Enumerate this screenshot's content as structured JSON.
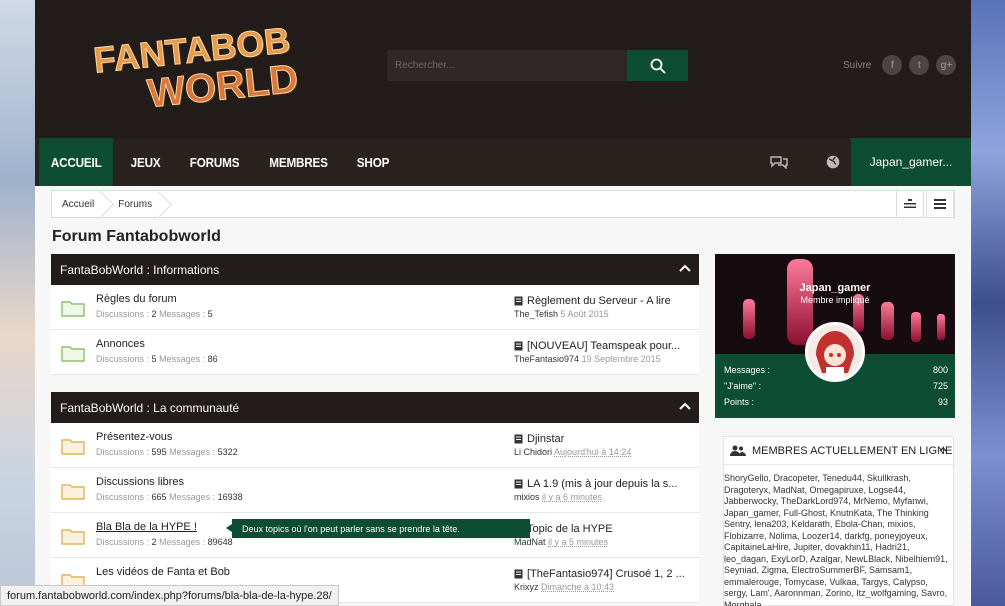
{
  "logo": {
    "line1": "FANTABOB",
    "line2": "WORLD"
  },
  "search": {
    "placeholder": "Rechercher..."
  },
  "follow": {
    "label": "Suivre",
    "icons": [
      "facebook-icon",
      "twitter-icon",
      "google-plus-icon"
    ],
    "glyphs": [
      "f",
      "t",
      "g+"
    ]
  },
  "nav": {
    "items": [
      "ACCUEIL",
      "JEUX",
      "FORUMS",
      "MEMBRES",
      "SHOP"
    ],
    "user": "Japan_gamer..."
  },
  "breadcrumb": [
    "Accueil",
    "Forums"
  ],
  "page_title": "Forum Fantabobworld",
  "categories": [
    {
      "title": "FantaBobWorld : Informations",
      "forums": [
        {
          "name": "Règles du forum",
          "discussions_label": "Discussions :",
          "discussions": "2",
          "messages_label": "Messages :",
          "messages": "5",
          "last_title": "Règlement du Serveur - A lire",
          "last_user": "The_Tefish",
          "last_date": "5 Août 2015",
          "read": true
        },
        {
          "name": "Annonces",
          "discussions_label": "Discussions :",
          "discussions": "5",
          "messages_label": "Messages :",
          "messages": "86",
          "last_title": "[NOUVEAU] Teamspeak pour...",
          "last_user": "TheFantasio974",
          "last_date": "19 Septembre 2015",
          "read": true
        }
      ]
    },
    {
      "title": "FantaBobWorld : La communauté",
      "forums": [
        {
          "name": "Présentez-vous",
          "discussions_label": "Discussions :",
          "discussions": "595",
          "messages_label": "Messages :",
          "messages": "5322",
          "last_title": "Djinstar",
          "last_user": "Li Chidori",
          "last_date": "Aujourd'hui à 14:24"
        },
        {
          "name": "Discussions libres",
          "discussions_label": "Discussions :",
          "discussions": "665",
          "messages_label": "Messages :",
          "messages": "16938",
          "last_title": "LA 1.9 (mis à jour depuis la s...",
          "last_user": "mixios",
          "last_date": "il y a 6 minutes"
        },
        {
          "name": "Bla Bla de la HYPE !",
          "discussions_label": "Discussions :",
          "discussions": "2",
          "messages_label": "Messages :",
          "messages": "89648",
          "last_title": "Topic de la HYPE",
          "last_user": "MadNat",
          "last_date": "il y a 5 minutes"
        },
        {
          "name": "Les vidéos de Fanta et Bob",
          "discussions_label": "",
          "discussions": "",
          "messages_label": "",
          "messages": "",
          "last_title": "[TheFantasio974] Crusoé 1, 2 ...",
          "last_user": "Krixyz",
          "last_date": "Dimanche à 10:43"
        }
      ]
    }
  ],
  "tooltip": "Deux topics où l'on peut parler sans se prendre la tête.",
  "user_card": {
    "name": "Japan_gamer",
    "rank": "Membre impliqué",
    "stats": [
      {
        "label": "Messages :",
        "value": "800"
      },
      {
        "label": "\"J'aime\" :",
        "value": "725"
      },
      {
        "label": "Points :",
        "value": "93"
      }
    ]
  },
  "online": {
    "title": "MEMBRES ACTUELLEMENT EN LIGNE",
    "members": "ShoryGello, Dracopeter, Tenedu44, Skullkrash, Dragoteryx, MadNat, Omegapiruxe, Logse44, Jabberwocky, TheDarkLord974, MrNemo, Myfanwi, Japan_gamer, Full-Ghost, KnutnKata, The Thinking Sentry, lena203, Keldarath, Ebola-Chan, mixios, Flobizarre, Nolima, Loozer14, darkfg, poneyjoyeux, CapitaineLaHire, Jupiter, dovakhin11, Hadri21, leo_dagan, ExyLorD, Azalgar, NewLBlack, Nibelhiem91, Seyniad, Zigma, ElectroSummerBF, Samsam1, emmalerouge, Tomycase, Vulkaa, Targys, Calypso, sergy, Lam', Aaronnman, Zorino, Itz_wolfgaming, Savro, Morghala"
  },
  "statusbar": "forum.fantabobworld.com/index.php?forums/bla-bla-de-la-hype.28/",
  "colors": {
    "green": "#0c4d33",
    "dark": "#221c1a",
    "nav": "#29221f"
  }
}
